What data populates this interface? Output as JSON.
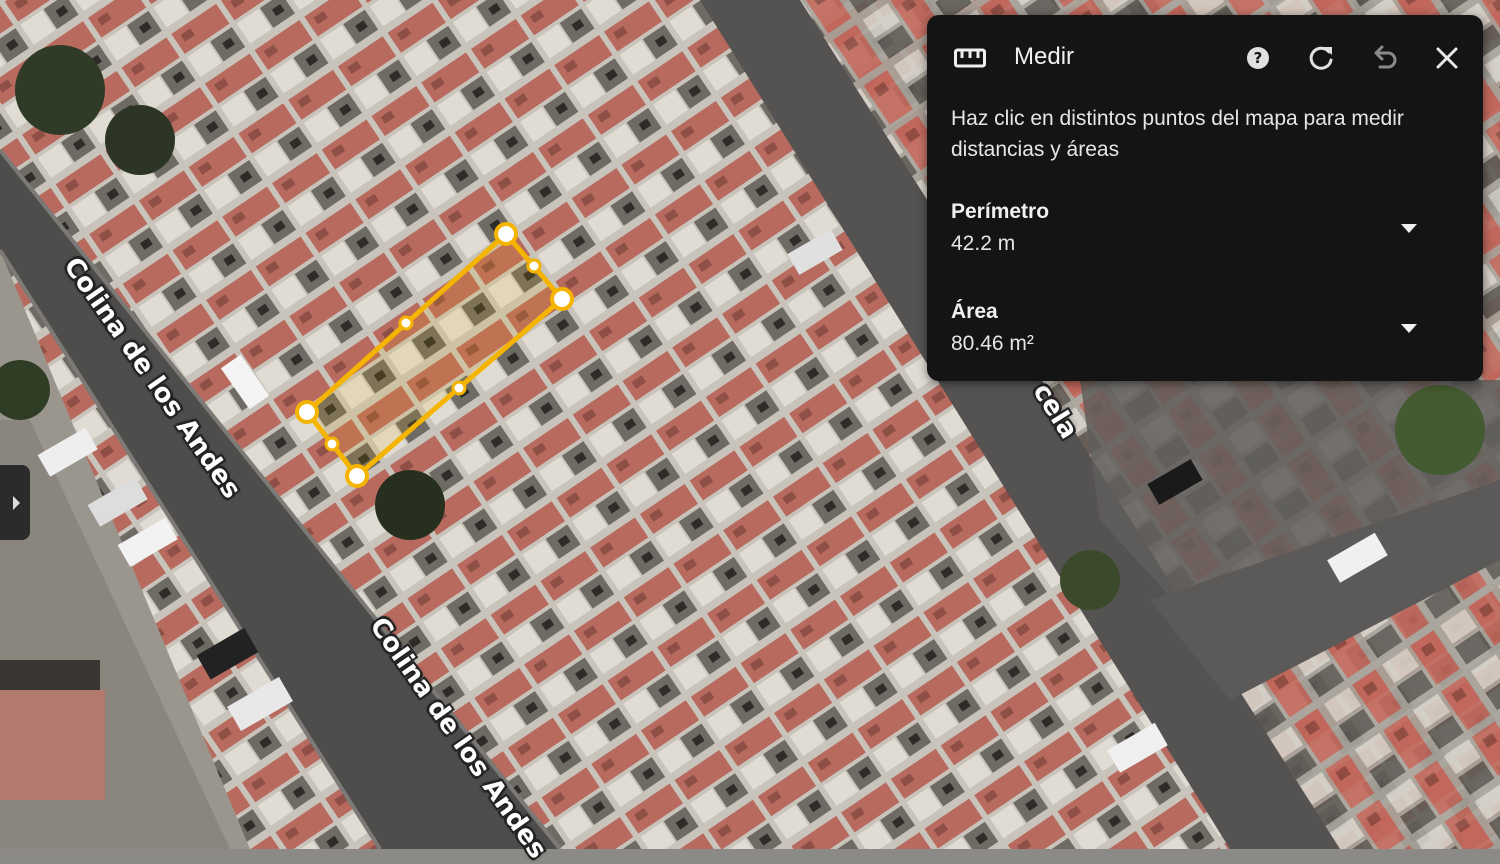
{
  "map": {
    "road_labels": [
      "Colina de los Andes",
      "Colina de los Andes",
      "cela"
    ],
    "measurement_color": "#f4b400",
    "roof_colors": [
      "#c06a60",
      "#b05a50",
      "#d8d4cc",
      "#9c9890",
      "#4a4642"
    ]
  },
  "panel": {
    "title": "Medir",
    "icons": [
      "ruler-icon",
      "help-icon",
      "refresh-icon",
      "undo-icon",
      "close-icon"
    ],
    "instructions": "Haz clic en distintos puntos del mapa para medir distancias y áreas",
    "perimeter_label": "Perímetro",
    "perimeter_value": "42.2 m",
    "area_label": "Área",
    "area_value": "80.46 m²"
  },
  "side_toggle": {
    "icon": "chevron-right-icon"
  }
}
